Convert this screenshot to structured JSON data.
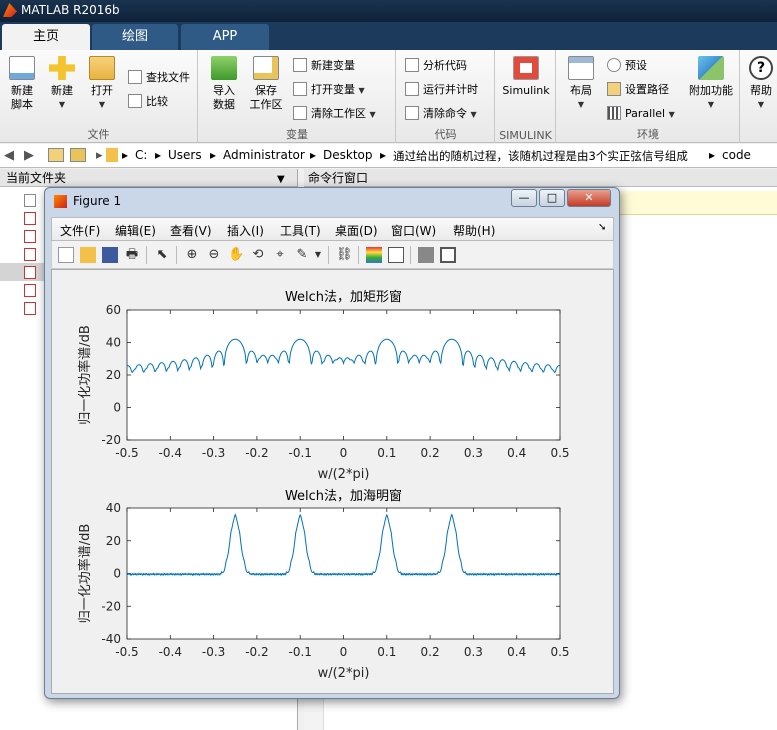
{
  "window": {
    "title": "MATLAB R2016b"
  },
  "tabs": [
    {
      "label": "主页",
      "active": true
    },
    {
      "label": "绘图",
      "active": false
    },
    {
      "label": "APP",
      "active": false
    }
  ],
  "ribbon": {
    "file": {
      "group_label": "文件",
      "new_script": [
        "新建",
        "脚本"
      ],
      "new": "新建",
      "open": "打开",
      "find_files": "查找文件",
      "compare": "比较"
    },
    "variable": {
      "group_label": "变量",
      "import": [
        "导入",
        "数据"
      ],
      "save": [
        "保存",
        "工作区"
      ],
      "new_var": "新建变量",
      "open_var": "打开变量",
      "clear_ws": "清除工作区"
    },
    "code": {
      "group_label": "代码",
      "analyze": "分析代码",
      "run_time": "运行并计时",
      "clear_cmd": "清除命令"
    },
    "simulink": {
      "group_label": "SIMULINK",
      "label": "Simulink"
    },
    "env": {
      "group_label": "环境",
      "layout": "布局",
      "prefs": "预设",
      "set_path": "设置路径",
      "parallel": "Parallel",
      "addons": "附加功能"
    },
    "resources": {
      "help": "帮助"
    }
  },
  "address": {
    "crumbs": [
      "C:",
      "Users",
      "Administrator",
      "Desktop",
      "通过给出的随机过程，该随机过程是由3个实正弦信号组成",
      "code"
    ]
  },
  "file_panel": {
    "title": "当前文件夹"
  },
  "command_panel": {
    "title": "命令行窗口"
  },
  "figure": {
    "title": "Figure 1",
    "menu": [
      "文件(F)",
      "编辑(E)",
      "查看(V)",
      "插入(I)",
      "工具(T)",
      "桌面(D)",
      "窗口(W)",
      "帮助(H)"
    ]
  },
  "chart_data": [
    {
      "type": "line",
      "title": "Welch法，加矩形窗",
      "xlabel": "w/(2*pi)",
      "ylabel": "归一化功率谱/dB",
      "xlim": [
        -0.5,
        0.5
      ],
      "ylim": [
        -20,
        60
      ],
      "xticks": [
        "-0.5",
        "-0.4",
        "-0.3",
        "-0.2",
        "-0.1",
        "0",
        "0.1",
        "0.2",
        "0.3",
        "0.4",
        "0.5"
      ],
      "yticks": [
        "-20",
        "0",
        "20",
        "40",
        "60"
      ],
      "color": "#0072bd",
      "peak_frequencies": [
        -0.25,
        -0.1,
        0.1,
        0.25
      ],
      "peak_level_db": 42,
      "grid": false
    },
    {
      "type": "line",
      "title": "Welch法，加海明窗",
      "xlabel": "w/(2*pi)",
      "ylabel": "归一化功率谱/dB",
      "xlim": [
        -0.5,
        0.5
      ],
      "ylim": [
        -40,
        40
      ],
      "xticks": [
        "-0.5",
        "-0.4",
        "-0.3",
        "-0.2",
        "-0.1",
        "0",
        "0.1",
        "0.2",
        "0.3",
        "0.4",
        "0.5"
      ],
      "yticks": [
        "-40",
        "-20",
        "0",
        "20",
        "40"
      ],
      "color": "#0072bd",
      "peak_frequencies": [
        -0.25,
        -0.1,
        0.1,
        0.25
      ],
      "peak_level_db": 36,
      "grid": false
    }
  ]
}
